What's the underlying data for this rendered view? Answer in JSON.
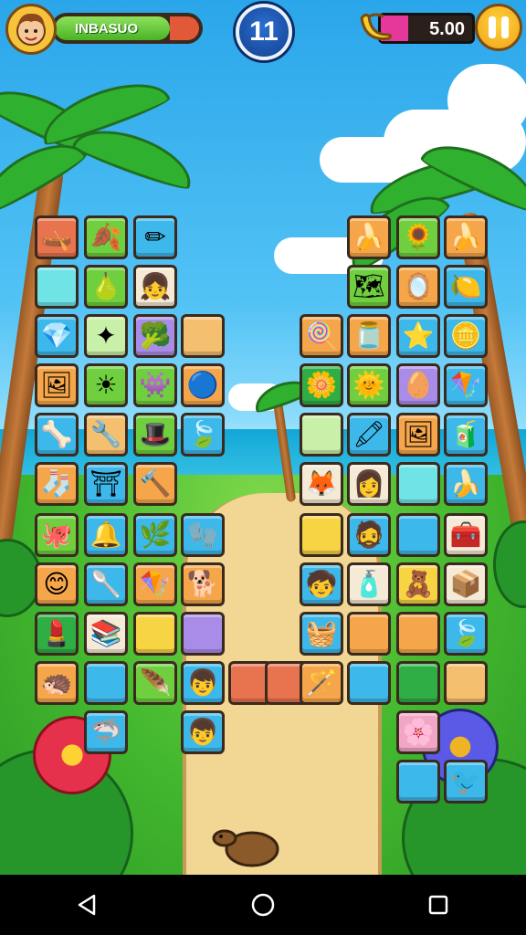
{
  "hud": {
    "player_name": "INBASUO",
    "xp_progress": 0.8,
    "level": "11",
    "coins": "5.00"
  },
  "colors": {
    "hud_green": "#6fcf3f",
    "hud_red": "#e2593a",
    "level_blue": "#1f56b5",
    "pause_yellow": "#f7b21e"
  },
  "board": {
    "tiles": [
      {
        "name": "tile-boat",
        "icon": "boat-icon",
        "glyph": "🛶",
        "color": "c-red"
      },
      {
        "name": "tile-spiky-leaf",
        "icon": "spiky-leaf-icon",
        "glyph": "🍂",
        "color": "c-green"
      },
      {
        "name": "tile-pencil",
        "icon": "pencil-icon",
        "glyph": "✏",
        "color": "c-blue"
      },
      {
        "name": "tile-empty",
        "icon": "blank-icon",
        "glyph": "",
        "color": "c-teal"
      },
      {
        "name": "tile-pear",
        "icon": "pear-icon",
        "glyph": "🍐",
        "color": "c-green"
      },
      {
        "name": "tile-character",
        "icon": "character-icon",
        "glyph": "👧",
        "color": "c-cream"
      },
      {
        "name": "tile-gem",
        "icon": "gem-icon",
        "glyph": "💎",
        "color": "c-blue"
      },
      {
        "name": "tile-star",
        "icon": "star-icon",
        "glyph": "✦",
        "color": "c-lime"
      },
      {
        "name": "tile-broccoli",
        "icon": "broccoli-icon",
        "glyph": "🥦",
        "color": "c-purple"
      },
      {
        "name": "tile-empty",
        "icon": "blank-icon",
        "glyph": "",
        "color": "c-sand"
      },
      {
        "name": "tile-picture",
        "icon": "picture-icon",
        "glyph": "🖼",
        "color": "c-orange"
      },
      {
        "name": "tile-sun",
        "icon": "sun-icon",
        "glyph": "☀",
        "color": "c-green"
      },
      {
        "name": "tile-monster",
        "icon": "monster-icon",
        "glyph": "👾",
        "color": "c-green"
      },
      {
        "name": "tile-ball",
        "icon": "ball-icon",
        "glyph": "🔵",
        "color": "c-orange"
      },
      {
        "name": "tile-bone",
        "icon": "bone-icon",
        "glyph": "🦴",
        "color": "c-blue"
      },
      {
        "name": "tile-tool",
        "icon": "tool-icon",
        "glyph": "🔧",
        "color": "c-sand"
      },
      {
        "name": "tile-hat",
        "icon": "hat-icon",
        "glyph": "🎩",
        "color": "c-green"
      },
      {
        "name": "tile-leaf",
        "icon": "leaf-icon",
        "glyph": "🍃",
        "color": "c-blue"
      },
      {
        "name": "tile-sock",
        "icon": "sock-icon",
        "glyph": "🧦",
        "color": "c-orange"
      },
      {
        "name": "tile-arch",
        "icon": "arch-icon",
        "glyph": "⛩",
        "color": "c-blue"
      },
      {
        "name": "tile-hammer",
        "icon": "hammer-icon",
        "glyph": "🔨",
        "color": "c-orange"
      },
      {
        "name": "tile-blob",
        "icon": "blob-icon",
        "glyph": "🐙",
        "color": "c-green"
      },
      {
        "name": "tile-bell",
        "icon": "bell-icon",
        "glyph": "🔔",
        "color": "c-blue"
      },
      {
        "name": "tile-bush",
        "icon": "bush-icon",
        "glyph": "🌿",
        "color": "c-blue"
      },
      {
        "name": "tile-glove",
        "icon": "glove-icon",
        "glyph": "🧤",
        "color": "c-blue"
      },
      {
        "name": "tile-smiley",
        "icon": "smiley-icon",
        "glyph": "😊",
        "color": "c-orange"
      },
      {
        "name": "tile-spoon",
        "icon": "spoon-icon",
        "glyph": "🥄",
        "color": "c-blue"
      },
      {
        "name": "tile-kite",
        "icon": "kite-icon",
        "glyph": "🪁",
        "color": "c-orange"
      },
      {
        "name": "tile-dog",
        "icon": "dog-icon",
        "glyph": "🐕",
        "color": "c-orange"
      },
      {
        "name": "tile-lipstick",
        "icon": "lipstick-icon",
        "glyph": "💄",
        "color": "c-dkgreen"
      },
      {
        "name": "tile-books",
        "icon": "books-icon",
        "glyph": "📚",
        "color": "c-cream"
      },
      {
        "name": "tile-empty",
        "icon": "blank-icon",
        "glyph": "",
        "color": "c-yellow"
      },
      {
        "name": "tile-empty",
        "icon": "blank-icon",
        "glyph": "",
        "color": "c-purple"
      },
      {
        "name": "tile-hedgehog",
        "icon": "hedgehog-icon",
        "glyph": "🦔",
        "color": "c-orange"
      },
      {
        "name": "tile-empty",
        "icon": "blank-icon",
        "glyph": "",
        "color": "c-blue"
      },
      {
        "name": "tile-feather",
        "icon": "feather-icon",
        "glyph": "🪶",
        "color": "c-green"
      },
      {
        "name": "tile-boy",
        "icon": "boy-icon",
        "glyph": "👦",
        "color": "c-blue"
      },
      {
        "name": "tile-shark",
        "icon": "shark-icon",
        "glyph": "🦈",
        "color": "c-blue"
      },
      {
        "name": "tile-boy-2",
        "icon": "boy-icon",
        "glyph": "👦",
        "color": "c-blue"
      },
      {
        "name": "tile-empty",
        "icon": "blank-icon",
        "glyph": "",
        "color": "c-red"
      },
      {
        "name": "tile-empty",
        "icon": "blank-icon",
        "glyph": "",
        "color": "c-red"
      },
      {
        "name": "tile-banana-r",
        "icon": "banana-icon",
        "glyph": "🍌",
        "color": "c-orange"
      },
      {
        "name": "tile-sun-r",
        "icon": "sun-icon",
        "glyph": "🌻",
        "color": "c-green"
      },
      {
        "name": "tile-banana-2",
        "icon": "banana-icon",
        "glyph": "🍌",
        "color": "c-orange"
      },
      {
        "name": "tile-map",
        "icon": "map-icon",
        "glyph": "🗺",
        "color": "c-green"
      },
      {
        "name": "tile-mirror",
        "icon": "mirror-icon",
        "glyph": "🪞",
        "color": "c-orange"
      },
      {
        "name": "tile-lemon",
        "icon": "lemon-icon",
        "glyph": "🍋",
        "color": "c-blue"
      },
      {
        "name": "tile-lollipop",
        "icon": "lollipop-icon",
        "glyph": "🍭",
        "color": "c-orange"
      },
      {
        "name": "tile-jar",
        "icon": "jar-icon",
        "glyph": "🫙",
        "color": "c-orange"
      },
      {
        "name": "tile-starfish",
        "icon": "starfish-icon",
        "glyph": "⭐",
        "color": "c-blue"
      },
      {
        "name": "tile-treasure",
        "icon": "treasure-icon",
        "glyph": "🪙",
        "color": "c-blue"
      },
      {
        "name": "tile-flower",
        "icon": "flower-icon",
        "glyph": "🌼",
        "color": "c-dkgreen"
      },
      {
        "name": "tile-sunface",
        "icon": "sunface-icon",
        "glyph": "🌞",
        "color": "c-green"
      },
      {
        "name": "tile-egg",
        "icon": "egg-icon",
        "glyph": "🥚",
        "color": "c-purple"
      },
      {
        "name": "tile-kite-2",
        "icon": "kite-icon",
        "glyph": "🪁",
        "color": "c-blue"
      },
      {
        "name": "tile-empty",
        "icon": "blank-icon",
        "glyph": "",
        "color": "c-lime"
      },
      {
        "name": "tile-crayon",
        "icon": "crayon-icon",
        "glyph": "🖍",
        "color": "c-blue"
      },
      {
        "name": "tile-frame",
        "icon": "frame-icon",
        "glyph": "🖼",
        "color": "c-orange"
      },
      {
        "name": "tile-box",
        "icon": "box-icon",
        "glyph": "🧃",
        "color": "c-blue"
      },
      {
        "name": "tile-fox",
        "icon": "fox-icon",
        "glyph": "🦊",
        "color": "c-cream"
      },
      {
        "name": "tile-girl",
        "icon": "girl-icon",
        "glyph": "👩",
        "color": "c-cream"
      },
      {
        "name": "tile-empty",
        "icon": "blank-icon",
        "glyph": "",
        "color": "c-teal"
      },
      {
        "name": "tile-banana-3",
        "icon": "banana-icon",
        "glyph": "🍌",
        "color": "c-blue"
      },
      {
        "name": "tile-empty",
        "icon": "blank-icon",
        "glyph": "",
        "color": "c-yellow"
      },
      {
        "name": "tile-man",
        "icon": "man-icon",
        "glyph": "🧔",
        "color": "c-blue"
      },
      {
        "name": "tile-empty",
        "icon": "blank-icon",
        "glyph": "",
        "color": "c-blue"
      },
      {
        "name": "tile-toolbox",
        "icon": "toolbox-icon",
        "glyph": "🧰",
        "color": "c-cream"
      },
      {
        "name": "tile-kid",
        "icon": "kid-icon",
        "glyph": "🧒",
        "color": "c-blue"
      },
      {
        "name": "tile-bottle",
        "icon": "bottle-icon",
        "glyph": "🧴",
        "color": "c-cream"
      },
      {
        "name": "tile-teddy",
        "icon": "teddy-icon",
        "glyph": "🧸",
        "color": "c-yellow"
      },
      {
        "name": "tile-crate",
        "icon": "crate-icon",
        "glyph": "📦",
        "color": "c-cream"
      },
      {
        "name": "tile-basket",
        "icon": "basket-icon",
        "glyph": "🧺",
        "color": "c-blue"
      },
      {
        "name": "tile-empty",
        "icon": "blank-icon",
        "glyph": "",
        "color": "c-orange"
      },
      {
        "name": "tile-empty",
        "icon": "blank-icon",
        "glyph": "",
        "color": "c-orange"
      },
      {
        "name": "tile-leaf-2",
        "icon": "leaf-icon",
        "glyph": "🍃",
        "color": "c-blue"
      },
      {
        "name": "tile-wand",
        "icon": "wand-icon",
        "glyph": "🪄",
        "color": "c-orange"
      },
      {
        "name": "tile-empty",
        "icon": "blank-icon",
        "glyph": "",
        "color": "c-blue"
      },
      {
        "name": "tile-empty",
        "icon": "blank-icon",
        "glyph": "",
        "color": "c-dkgreen"
      },
      {
        "name": "tile-empty",
        "icon": "blank-icon",
        "glyph": "",
        "color": "c-sand"
      },
      {
        "name": "tile-sunflower",
        "icon": "sunflower-icon",
        "glyph": "🌸",
        "color": "c-pink"
      },
      {
        "name": "tile-empty",
        "icon": "blank-icon",
        "glyph": "",
        "color": "c-blue"
      },
      {
        "name": "tile-bird",
        "icon": "bird-icon",
        "glyph": "🐦",
        "color": "c-blue"
      },
      {
        "name": "tile-boy-3",
        "icon": "boy-icon",
        "glyph": "👦",
        "color": "c-blue"
      }
    ]
  },
  "nav": {
    "back": "◁",
    "home": "○",
    "recents": "□"
  }
}
